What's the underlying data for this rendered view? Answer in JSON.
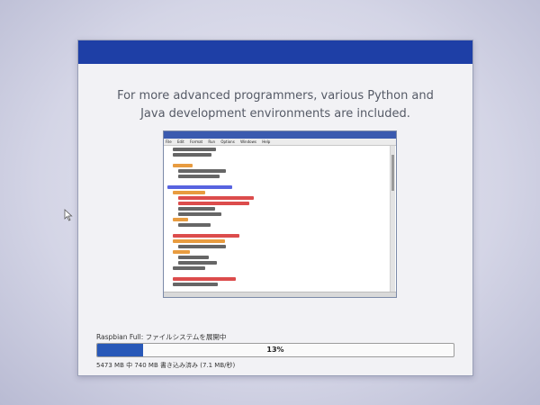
{
  "installer": {
    "headline_line1": "For more advanced programmers, various Python and",
    "headline_line2": "Java development environments are included.",
    "status_text": "Raspbian Full: ファイルシステムを展開中",
    "progress": {
      "percent": 13,
      "label": "13%"
    },
    "write_stats": "5473 MB 中 740 MB 書き込み済み (7.1 MB/秒)"
  },
  "ide_preview": {
    "menu": [
      "File",
      "Edit",
      "Format",
      "Run",
      "Options",
      "Windows",
      "Help"
    ]
  },
  "colors": {
    "titlebar": "#1e3fa6",
    "progress_fill": "#2858b8",
    "code_default": "#333333",
    "code_keyword": "#e07b00",
    "code_comment": "#d01010",
    "code_string": "#1a8a1a",
    "code_def": "#1f2fd6"
  }
}
